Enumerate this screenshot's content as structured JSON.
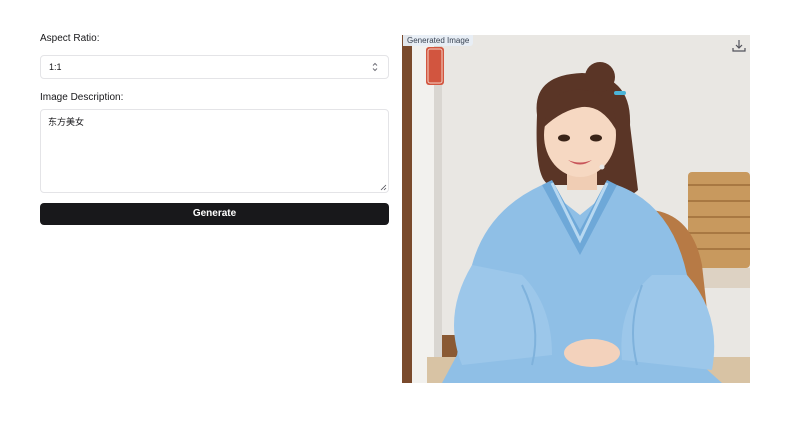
{
  "form": {
    "aspect_label": "Aspect Ratio:",
    "aspect_value": "1:1",
    "description_label": "Image Description:",
    "description_text": "东方美女",
    "generate_label": "Generate"
  },
  "image_panel": {
    "tag": "Generated Image",
    "download_icon": "download-icon",
    "stamp_text": "乾乾福"
  },
  "colors": {
    "button_bg": "#18181b",
    "border": "#e4e4e7",
    "robe": "#8fbfe6",
    "stamp": "#d2553f"
  }
}
